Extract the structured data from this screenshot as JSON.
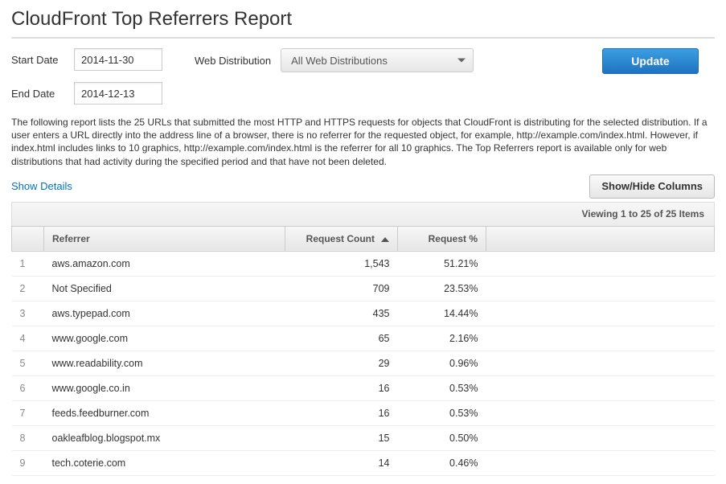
{
  "page": {
    "title": "CloudFront Top Referrers Report"
  },
  "filters": {
    "start_label": "Start Date",
    "end_label": "End Date",
    "start_value": "2014-11-30",
    "end_value": "2014-12-13",
    "dist_label": "Web Distribution",
    "dist_selected": "All Web Distributions",
    "update_label": "Update"
  },
  "description": "The following report lists the 25 URLs that submitted the most HTTP and HTTPS requests for objects that CloudFront is distributing for the selected distribution. If a user enters a URL directly into the address line of a browser, there is no referrer for the requested object, for example, http://example.com/index.html. However, if index.html includes links to 10 graphics, http://example.com/index.html is the referrer for all 10 graphics. The Top Referrers report is available only for web distributions that had activity during the specified period and that have not been deleted.",
  "links": {
    "show_details": "Show Details",
    "showhide_columns": "Show/Hide Columns"
  },
  "pager": {
    "text": "Viewing 1 to 25 of 25 Items"
  },
  "table": {
    "headers": {
      "referrer": "Referrer",
      "count": "Request Count",
      "percent": "Request %"
    },
    "rows": [
      {
        "idx": "1",
        "referrer": "aws.amazon.com",
        "count": "1,543",
        "percent": "51.21%"
      },
      {
        "idx": "2",
        "referrer": "Not Specified",
        "count": "709",
        "percent": "23.53%"
      },
      {
        "idx": "3",
        "referrer": "aws.typepad.com",
        "count": "435",
        "percent": "14.44%"
      },
      {
        "idx": "4",
        "referrer": "www.google.com",
        "count": "65",
        "percent": "2.16%"
      },
      {
        "idx": "5",
        "referrer": "www.readability.com",
        "count": "29",
        "percent": "0.96%"
      },
      {
        "idx": "6",
        "referrer": "www.google.co.in",
        "count": "16",
        "percent": "0.53%"
      },
      {
        "idx": "7",
        "referrer": "feeds.feedburner.com",
        "count": "16",
        "percent": "0.53%"
      },
      {
        "idx": "8",
        "referrer": "oakleafblog.blogspot.mx",
        "count": "15",
        "percent": "0.50%"
      },
      {
        "idx": "9",
        "referrer": "tech.coterie.com",
        "count": "14",
        "percent": "0.46%"
      }
    ]
  }
}
